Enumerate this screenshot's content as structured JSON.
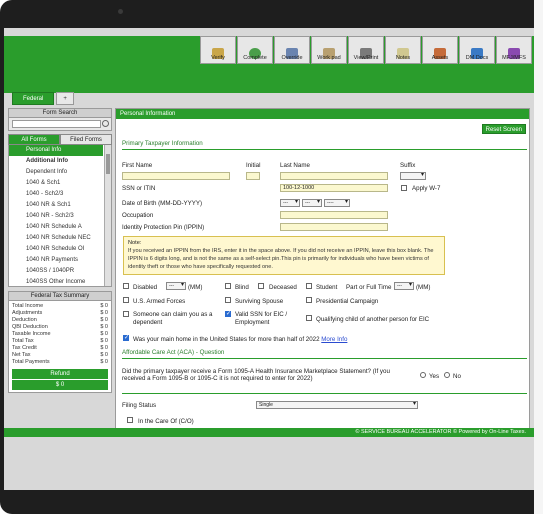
{
  "toolbar": {
    "items": [
      {
        "label": "Verify",
        "icon": "verify-icon"
      },
      {
        "label": "Complete",
        "icon": "complete-icon"
      },
      {
        "label": "Override",
        "icon": "override-icon"
      },
      {
        "label": "Work pad",
        "icon": "workpad-icon"
      },
      {
        "label": "View/Print",
        "icon": "print-icon"
      },
      {
        "label": "Notes",
        "icon": "notes-icon"
      },
      {
        "label": "Assets",
        "icon": "assets-icon"
      },
      {
        "label": "DM Docs",
        "icon": "documents-icon"
      },
      {
        "label": "MFJ/MFS",
        "icon": "mfj-icon"
      }
    ]
  },
  "tabs": {
    "federal": "Federal",
    "add": "+"
  },
  "sidebar": {
    "form_search_title": "Form Search",
    "all_forms": "All Forms",
    "filed_forms": "Filed Forms",
    "forms": [
      "Personal Info",
      "Additional Info",
      "Dependent Info",
      "1040 & Sch1",
      "1040 - Sch2/3",
      "1040 NR & Sch1",
      "1040 NR - Sch2/3",
      "1040 NR Schedule A",
      "1040 NR Schedule NEC",
      "1040 NR Schedule OI",
      "1040 NR Payments",
      "1040SS / 1040PR",
      "1040SS Other Income"
    ],
    "summary_title": "Federal Tax Summary",
    "summary_rows": [
      {
        "label": "Total Income",
        "value": "$ 0"
      },
      {
        "label": "Adjustments",
        "value": "$ 0"
      },
      {
        "label": "Deduction",
        "value": "$ 0"
      },
      {
        "label": "QBI Deduction",
        "value": "$ 0"
      },
      {
        "label": "Taxable Income",
        "value": "$ 0"
      },
      {
        "label": "Total Tax",
        "value": "$ 0"
      },
      {
        "label": "Tax Credit",
        "value": "$ 0"
      },
      {
        "label": "Net Tax",
        "value": "$ 0"
      },
      {
        "label": "Total Payments",
        "value": "$ 0"
      }
    ],
    "refund_label": "Refund",
    "refund_value": "$ 0"
  },
  "main": {
    "header": "Personal Information",
    "reset_button": "Reset Screen",
    "section_title": "Primary Taxpayer Information",
    "first_name_label": "First Name",
    "initial_label": "Initial",
    "last_name_label": "Last Name",
    "suffix_label": "Suffix",
    "ssn_label": "SSN or ITIN",
    "ssn_value": "100-12-1000",
    "apply_w7_label": "Apply W-7",
    "dob_label": "Date of Birth (MM-DD-YYYY)",
    "dob_month": "---",
    "dob_day": "---",
    "dob_year": "----",
    "occupation_label": "Occupation",
    "ippin_label": "Identity Protection Pin (IPPIN)",
    "note_title": "Note:",
    "note_text": "If you received an IPPIN from the IRS, enter it in the space above. If you did not receive an IPPIN, leave this box blank. The IPPIN is 6 digits long, and is not the same as a self-select pin.This pin is primarily for individuals who have been victims of identity theft or those who have specifically requested one.",
    "disabled_label": "Disabled",
    "disabled_select": "---",
    "mm_label": "(MM)",
    "blind_label": "Blind",
    "deceased_label": "Deceased",
    "student_label": "Student",
    "part_full_label": "Part or Full Time",
    "part_full_select": "---",
    "us_armed_label": "U.S. Armed Forces",
    "surviving_label": "Surviving Spouse",
    "presidential_label": "Presidential Campaign",
    "someone_claim_label": "Someone can claim you as a dependent",
    "valid_ssn_label": "Valid SSN for EIC / Employment",
    "qualifying_label": "Qualifying child of another person for EIC",
    "main_home_label": "Was your main home in the United States for more than half of 2022",
    "more_info_link": "More Info",
    "aca_title": "Affordable Care Act (ACA) - Question",
    "aca_question": "Did the primary taxpayer receive a Form 1095-A Health Insurance Marketplace Statement? (If you received a Form 1095-B or 1095-C it is not required to enter for 2022)",
    "yes_label": "Yes",
    "no_label": "No",
    "filing_status_label": "Filing Status",
    "filing_status_value": "Single",
    "care_of_label": "In the Care Of (C/O)"
  },
  "footer": "© SERVICE BUREAU ACCELERATOR © Powered by On-Line Taxes."
}
